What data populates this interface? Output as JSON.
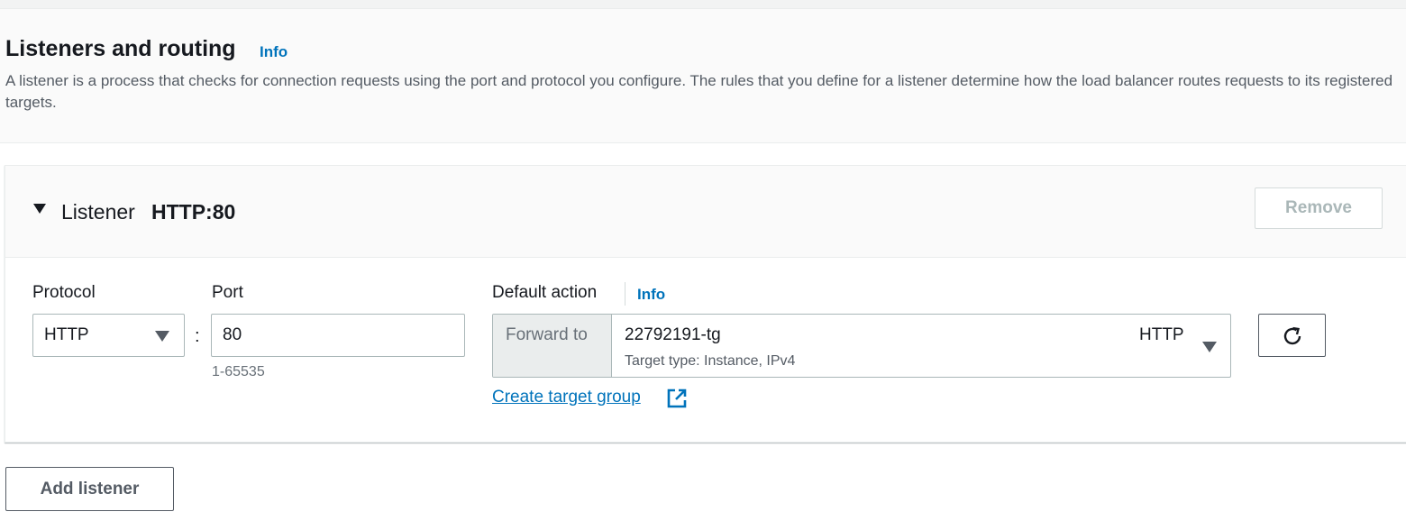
{
  "section": {
    "title": "Listeners and routing",
    "info_label": "Info",
    "description": "A listener is a process that checks for connection requests using the port and protocol you configure. The rules that you define for a listener determine how the load balancer routes requests to its registered targets."
  },
  "listener": {
    "label": "Listener",
    "name": "HTTP:80",
    "remove_label": "Remove",
    "protocol": {
      "label": "Protocol",
      "value": "HTTP"
    },
    "separator": ":",
    "port": {
      "label": "Port",
      "value": "80",
      "hint": "1-65535"
    },
    "default_action": {
      "label": "Default action",
      "info_label": "Info",
      "forward_label": "Forward to",
      "target_group_name": "22792191-tg",
      "target_group_detail": "Target type: Instance, IPv4",
      "target_group_protocol": "HTTP",
      "create_link": "Create target group"
    }
  },
  "footer": {
    "add_listener_label": "Add listener"
  },
  "icons": {
    "collapse": "caret-down-icon",
    "dropdown": "triangle-down-icon",
    "external": "external-link-icon",
    "refresh": "refresh-icon"
  },
  "colors": {
    "link": "#0073bb",
    "text": "#16191f",
    "muted": "#545b64",
    "panel_bg": "#fafafa",
    "border": "#aab7b8"
  }
}
